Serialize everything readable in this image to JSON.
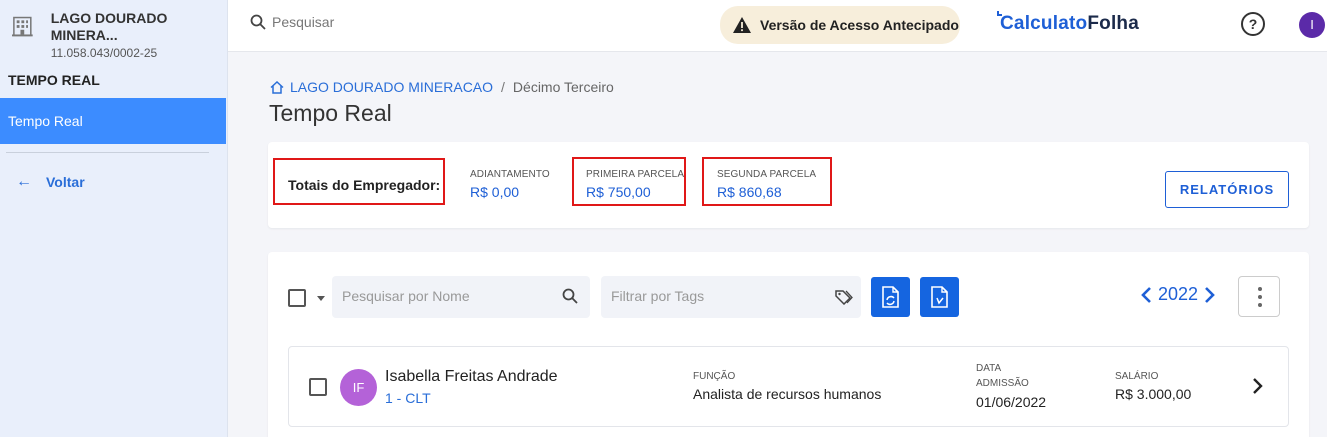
{
  "sidebar": {
    "company_name": "LAGO DOURADO MINERA...",
    "company_cnpj": "11.058.043/0002-25",
    "section_title": "TEMPO REAL",
    "active_item": "Tempo Real",
    "back_label": "Voltar",
    "icons": {
      "company": "building-icon",
      "back": "arrow-left-icon"
    }
  },
  "topbar": {
    "search_placeholder": "Pesquisar",
    "early_access": "Versão de Acesso Antecipado",
    "logo_part1": "Calculato",
    "logo_part2": "Folha",
    "help": "?",
    "user_initial": "I",
    "colors": {
      "accent": "#1e5fd6",
      "user_avatar": "#5b2aa8",
      "early_bg": "#f7eedb"
    }
  },
  "breadcrumb": {
    "company": "LAGO DOURADO MINERACAO",
    "separator": "/",
    "current": "Décimo Terceiro"
  },
  "page_title": "Tempo Real",
  "totals": {
    "label": "Totais do Empregador:",
    "adiantamento": {
      "label": "ADIANTAMENTO",
      "value": "R$ 0,00"
    },
    "primeira": {
      "label": "PRIMEIRA PARCELA",
      "value": "R$ 750,00"
    },
    "segunda": {
      "label": "SEGUNDA PARCELA",
      "value": "R$ 860,68"
    },
    "relatorios_label": "RELATÓRIOS",
    "highlight_color": "#e01818"
  },
  "toolbar": {
    "name_placeholder": "Pesquisar por Nome",
    "tags_placeholder": "Filtrar por Tags",
    "year": "2022"
  },
  "employees": [
    {
      "initials": "IF",
      "name": "Isabella Freitas Andrade",
      "contract": "1 - CLT",
      "funcao_label": "FUNÇÃO",
      "funcao": "Analista de recursos humanos",
      "admissao_label_1": "DATA",
      "admissao_label_2": "ADMISSÃO",
      "admissao": "01/06/2022",
      "salario_label": "SALÁRIO",
      "salario": "R$ 3.000,00",
      "avatar_color": "#b462d8"
    }
  ]
}
